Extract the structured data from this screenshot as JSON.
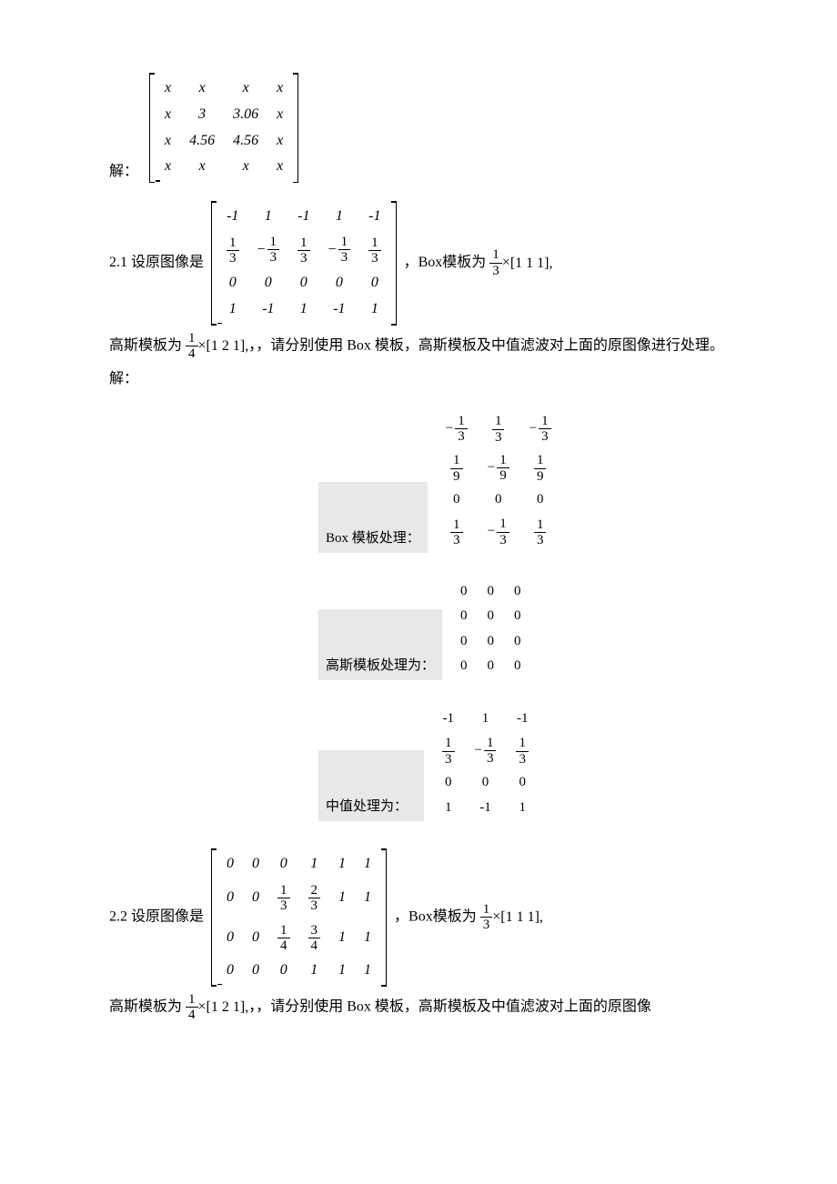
{
  "answer_prefix": "解：",
  "matrix1": {
    "r1": [
      "x",
      "x",
      "x",
      "x"
    ],
    "r2": [
      "x",
      "3",
      "3.06",
      "x"
    ],
    "r3": [
      "x",
      "4.56",
      "4.56",
      "x"
    ],
    "r4": [
      "x",
      "x",
      "x",
      "x"
    ]
  },
  "problem21": {
    "label": "2.1 设原图像是",
    "box_text": "Box模板为",
    "box_frac_num": "1",
    "box_frac_den": "3",
    "box_vec": "[1   1   1],",
    "gauss_text": "高斯模板为",
    "gauss_frac_num": "1",
    "gauss_frac_den": "4",
    "gauss_vec": "[1   2   1],",
    "instruction": "，，请分别使用 Box 模板，高斯模板及中值滤波对上面的原图像进行处理。",
    "solution_label": "解：",
    "matrix": {
      "r1": [
        "-1",
        "1",
        "-1",
        "1",
        "-1"
      ],
      "r2f": [
        {
          "n": "1",
          "d": "3"
        },
        {
          "neg": true,
          "n": "1",
          "d": "3"
        },
        {
          "n": "1",
          "d": "3"
        },
        {
          "neg": true,
          "n": "1",
          "d": "3"
        },
        {
          "n": "1",
          "d": "3"
        }
      ],
      "r3": [
        "0",
        "0",
        "0",
        "0",
        "0"
      ],
      "r4": [
        "1",
        "-1",
        "1",
        "-1",
        "1"
      ]
    }
  },
  "box_result": {
    "label": "Box 模板处理：",
    "rows": [
      [
        {
          "neg": true,
          "n": "1",
          "d": "3"
        },
        {
          "n": "1",
          "d": "3"
        },
        {
          "neg": true,
          "n": "1",
          "d": "3"
        }
      ],
      [
        {
          "n": "1",
          "d": "9"
        },
        {
          "neg": true,
          "n": "1",
          "d": "9"
        },
        {
          "n": "1",
          "d": "9"
        }
      ],
      [
        {
          "v": "0"
        },
        {
          "v": "0"
        },
        {
          "v": "0"
        }
      ],
      [
        {
          "n": "1",
          "d": "3"
        },
        {
          "neg": true,
          "n": "1",
          "d": "3"
        },
        {
          "n": "1",
          "d": "3"
        }
      ]
    ]
  },
  "gauss_result": {
    "label": "高斯模板处理为：",
    "rows": [
      [
        "0",
        "0",
        "0"
      ],
      [
        "0",
        "0",
        "0"
      ],
      [
        "0",
        "0",
        "0"
      ],
      [
        "0",
        "0",
        "0"
      ]
    ]
  },
  "median_result": {
    "label": "中值处理为：",
    "rows": [
      [
        {
          "v": "-1"
        },
        {
          "v": "1"
        },
        {
          "v": "-1"
        }
      ],
      [
        {
          "n": "1",
          "d": "3"
        },
        {
          "neg": true,
          "n": "1",
          "d": "3"
        },
        {
          "n": "1",
          "d": "3"
        }
      ],
      [
        {
          "v": "0"
        },
        {
          "v": "0"
        },
        {
          "v": "0"
        }
      ],
      [
        {
          "v": "1"
        },
        {
          "v": "-1"
        },
        {
          "v": "1"
        }
      ]
    ]
  },
  "problem22": {
    "label": "2.2 设原图像是",
    "box_text": "Box模板为",
    "box_frac_num": "1",
    "box_frac_den": "3",
    "box_vec": "[1   1   1],",
    "gauss_text": "高斯模板为",
    "gauss_frac_num": "1",
    "gauss_frac_den": "4",
    "gauss_vec": "[1   2   1],",
    "instruction": "，，请分别使用 Box 模板，高斯模板及中值滤波对上面的原图像",
    "matrix": {
      "r1": [
        "0",
        "0",
        "0",
        "1",
        "1",
        "1"
      ],
      "r2": [
        {
          "v": "0"
        },
        {
          "v": "0"
        },
        {
          "n": "1",
          "d": "3"
        },
        {
          "n": "2",
          "d": "3"
        },
        {
          "v": "1"
        },
        {
          "v": "1"
        }
      ],
      "r3": [
        {
          "v": "0"
        },
        {
          "v": "0"
        },
        {
          "n": "1",
          "d": "4"
        },
        {
          "n": "3",
          "d": "4"
        },
        {
          "v": "1"
        },
        {
          "v": "1"
        }
      ],
      "r4": [
        "0",
        "0",
        "0",
        "1",
        "1",
        "1"
      ]
    }
  }
}
